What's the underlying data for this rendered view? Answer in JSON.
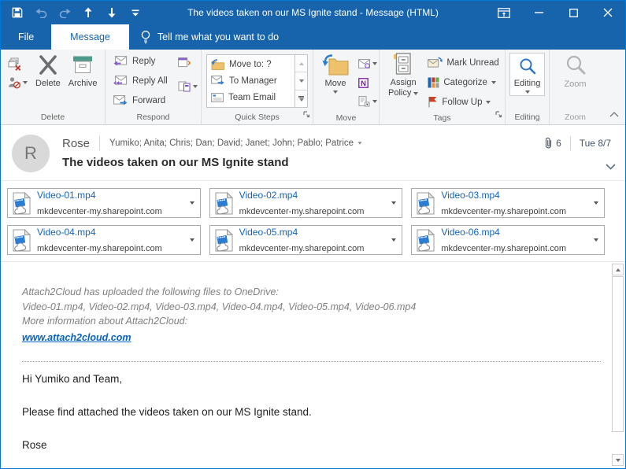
{
  "colors": {
    "titlebar_blue": "#1763ac",
    "window_border_blue": "#0078d7",
    "hyperlink_blue": "#0563c1",
    "attachment_name_blue": "#1464ba",
    "onenote_purple": "#7719aa",
    "follow_up_red": "#cc4125",
    "archive_teal": "#4f9a8c",
    "folder_tan": "#eec26d"
  },
  "titlebar": {
    "title": "The videos taken on our MS Ignite stand  -  Message (HTML)",
    "quick_access_icons": [
      "save-icon",
      "undo-icon",
      "redo-icon",
      "move-up-icon",
      "move-down-icon",
      "customize-quick-access-icon"
    ],
    "window_control_icons": [
      "ribbon-display-options-icon",
      "minimize-icon",
      "maximize-icon",
      "close-icon"
    ]
  },
  "tabs": {
    "file": "File",
    "message": "Message",
    "tell_me": "Tell me what you want to do"
  },
  "ribbon": {
    "delete_group": {
      "label": "Delete",
      "delete": "Delete",
      "archive": "Archive",
      "icons": [
        "ignore-icon",
        "junk-icon",
        "delete-x-icon",
        "archive-icon"
      ]
    },
    "respond_group": {
      "label": "Respond",
      "reply": "Reply",
      "reply_all": "Reply All",
      "forward": "Forward",
      "icons": [
        "reply-icon",
        "reply-all-icon",
        "forward-icon",
        "meeting-icon",
        "im-icon"
      ]
    },
    "quick_steps_group": {
      "label": "Quick Steps",
      "items": [
        {
          "label": "Move to: ?",
          "icon": "folder-move-icon"
        },
        {
          "label": "To Manager",
          "icon": "envelope-forward-icon"
        },
        {
          "label": "Team Email",
          "icon": "team-email-icon"
        }
      ]
    },
    "move_group": {
      "label": "Move",
      "move": "Move",
      "icons": [
        "move-folder-icon",
        "rules-icon",
        "onenote-icon",
        "actions-icon"
      ]
    },
    "tags_group": {
      "label": "Tags",
      "assign_policy_line1": "Assign",
      "assign_policy_line2": "Policy",
      "mark_unread": "Mark Unread",
      "categorize": "Categorize",
      "follow_up": "Follow Up",
      "icons": [
        "assign-policy-icon",
        "mark-unread-icon",
        "categorize-icon",
        "follow-up-flag-icon"
      ]
    },
    "editing_group": {
      "label": "Editing",
      "editing": "Editing",
      "icons": [
        "editing-search-icon"
      ]
    },
    "zoom_group": {
      "label": "Zoom",
      "zoom": "Zoom",
      "icons": [
        "zoom-magnifier-icon"
      ]
    }
  },
  "message_header": {
    "sender_initial": "R",
    "sender_name": "Rose",
    "recipients": "Yumiko; Anita; Chris; Dan; David; Janet; John; Pablo; Patrice",
    "subject": "The videos taken on our MS Ignite stand",
    "attachment_count": "6",
    "received": "Tue 8/7"
  },
  "attachments": [
    {
      "name": "Video-01.mp4",
      "source": "mkdevcenter-my.sharepoint.com"
    },
    {
      "name": "Video-02.mp4",
      "source": "mkdevcenter-my.sharepoint.com"
    },
    {
      "name": "Video-03.mp4",
      "source": "mkdevcenter-my.sharepoint.com"
    },
    {
      "name": "Video-04.mp4",
      "source": "mkdevcenter-my.sharepoint.com"
    },
    {
      "name": "Video-05.mp4",
      "source": "mkdevcenter-my.sharepoint.com"
    },
    {
      "name": "Video-06.mp4",
      "source": "mkdevcenter-my.sharepoint.com"
    }
  ],
  "body": {
    "upload_notice_line1": "Attach2Cloud has uploaded the following files to OneDrive:",
    "upload_notice_line2": "Video-01.mp4, Video-02.mp4, Video-03.mp4, Video-04.mp4, Video-05.mp4, Video-06.mp4",
    "more_info_label": "More information about Attach2Cloud:",
    "link_text": "www.attach2cloud.com",
    "greeting": "Hi Yumiko and Team,",
    "message_line": "Please find attached the videos taken on our MS Ignite stand.",
    "signature": "Rose"
  }
}
